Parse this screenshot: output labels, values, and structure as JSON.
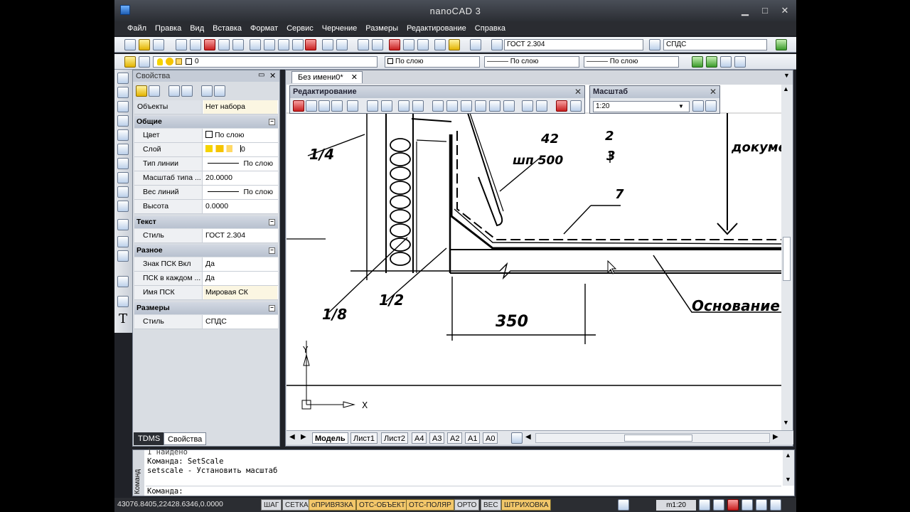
{
  "app": {
    "title": "nanoCAD 3"
  },
  "menu": [
    "Файл",
    "Правка",
    "Вид",
    "Вставка",
    "Формат",
    "Сервис",
    "Черчение",
    "Размеры",
    "Редактирование",
    "Справка"
  ],
  "toolbar": {
    "text_style": "ГОСТ 2.304",
    "dim_style": "СПДС",
    "layer_value": "0",
    "color_combo": "По слою",
    "linetype_combo": "——— По слою",
    "lineweight_combo": "——— По слою"
  },
  "properties": {
    "title": "Свойства",
    "objects_label": "Объекты",
    "objects_value": "Нет набора",
    "sections": [
      {
        "name": "Общие",
        "rows": [
          {
            "k": "Цвет",
            "v": "По слою"
          },
          {
            "k": "Слой",
            "v": "0"
          },
          {
            "k": "Тип линии",
            "v": "По слою"
          },
          {
            "k": "Масштаб типа ...",
            "v": "20.0000"
          },
          {
            "k": "Вес линий",
            "v": "По слою"
          },
          {
            "k": "Высота",
            "v": "0.0000"
          }
        ]
      },
      {
        "name": "Текст",
        "rows": [
          {
            "k": "Стиль",
            "v": "ГОСТ 2.304"
          }
        ]
      },
      {
        "name": "Разное",
        "rows": [
          {
            "k": "Знак ПСК Вкл",
            "v": "Да"
          },
          {
            "k": "ПСК в каждом ...",
            "v": "Да"
          },
          {
            "k": "Имя ПСК",
            "v": "Мировая СК"
          }
        ]
      },
      {
        "name": "Размеры",
        "rows": [
          {
            "k": "Стиль",
            "v": "СПДС"
          }
        ]
      }
    ],
    "tabs": [
      "TDMS",
      "Свойства"
    ]
  },
  "document": {
    "tab": "Без имени0*",
    "layout_tabs": [
      "Модель",
      "Лист1",
      "Лист2",
      "А4",
      "А3",
      "А2",
      "А1",
      "А0"
    ]
  },
  "panel_edit": {
    "title": "Редактирование"
  },
  "panel_scale": {
    "title": "Масштаб",
    "value": "1:20"
  },
  "drawing": {
    "labels": [
      "1/4",
      "42",
      "шп 500",
      "2",
      "3",
      "7",
      "1/8",
      "1/2",
      "350",
      "Основание",
      "документ"
    ],
    "ucs": {
      "x": "X",
      "y": "Y"
    }
  },
  "command": {
    "side": "Команд",
    "lines": [
      "1 найдено",
      "Команда: SetScale",
      "setscale - Установить масштаб",
      "Команда:"
    ]
  },
  "status": {
    "coords": "43076.8405,22428.6346,0.0000",
    "buttons": [
      "ШАГ",
      "СЕТКА",
      "оПРИВЯЗКА",
      "ОТС-ОБЪЕКТ",
      "ОТС-ПОЛЯР",
      "ОРТО",
      "ВЕС",
      "ШТРИХОВКА"
    ],
    "active": [
      false,
      false,
      true,
      true,
      true,
      false,
      false,
      true
    ],
    "scale": "m1:20"
  }
}
